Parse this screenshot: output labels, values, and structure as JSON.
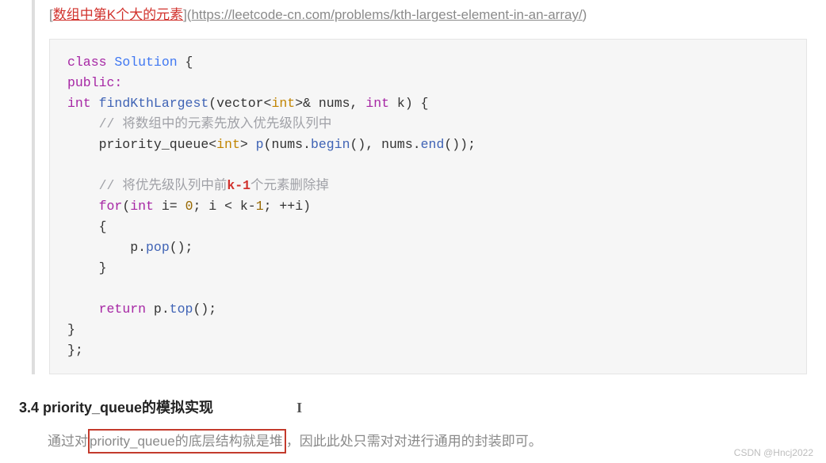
{
  "links": {
    "open_bracket": "[",
    "title_text": "数组中第K个大的元素",
    "mid": "](",
    "url_text": "https://leetcode-cn.com/problems/kth-largest-element-in-an-array/",
    "close_bracket": ")"
  },
  "code": {
    "l1_class": "class",
    "l1_name": "Solution",
    "l1_brace": " {",
    "l2": "public:",
    "l3_int": "int",
    "l3_fn": " findKthLargest",
    "l3_open": "(vector<",
    "l3_prim": "int",
    "l3_rest": ">& nums, ",
    "l3_int2": "int",
    "l3_krest": " k) {",
    "l4_indent": "    ",
    "l4_com": "// 将数组中的元素先放入优先级队列中",
    "l5_indent": "    priority_queue<",
    "l5_prim": "int",
    "l5_after": "> ",
    "l5_fn": "p",
    "l5_open": "(nums.",
    "l5_beg": "begin",
    "l5_mid": "(), nums.",
    "l5_end": "end",
    "l5_close": "());",
    "l6_blank": "",
    "l7_indent": "    ",
    "l7_com_a": "// 将优先级队列中前",
    "l7_hl": "k-1",
    "l7_com_b": "个元素删除掉",
    "l8_indent": "    ",
    "l8_for": "for",
    "l8_open": "(",
    "l8_int": "int",
    "l8_rest": " i= ",
    "l8_zero": "0",
    "l8_s": "; i < k-",
    "l8_one": "1",
    "l8_tail": "; ++i)",
    "l9": "    {",
    "l10_indent": "        p.",
    "l10_fn": "pop",
    "l10_close": "();",
    "l11": "    }",
    "l12_blank": "",
    "l13_indent": "    ",
    "l13_ret": "return",
    "l13_mid": " p.",
    "l13_fn": "top",
    "l13_close": "();",
    "l14": "}",
    "l15": "};"
  },
  "section": {
    "number": "3.4 ",
    "title": "priority_queue的模拟实现"
  },
  "paragraph": {
    "lead": "通过对",
    "boxed": "priority_queue的底层结构就是堆",
    "tail": "，因此此处只需对对进行通用的封装即可。"
  },
  "watermark": "CSDN @Hncj2022"
}
